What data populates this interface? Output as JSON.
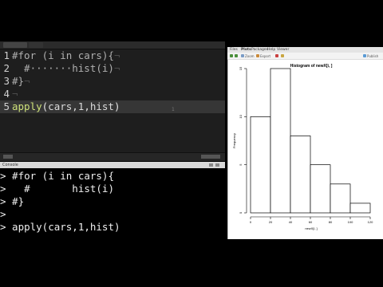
{
  "editor": {
    "lines": [
      {
        "num": "1",
        "tokens": [
          {
            "t": "#for (i in cars){",
            "c": "comment"
          },
          {
            "t": "¬",
            "c": "ws"
          }
        ]
      },
      {
        "num": "2",
        "tokens": [
          {
            "t": "  #·······hist(i)",
            "c": "comment"
          },
          {
            "t": "¬",
            "c": "ws"
          }
        ]
      },
      {
        "num": "3",
        "tokens": [
          {
            "t": "#}",
            "c": "comment"
          },
          {
            "t": "¬",
            "c": "ws"
          }
        ]
      },
      {
        "num": "4",
        "tokens": [
          {
            "t": "¬",
            "c": "ws"
          }
        ]
      },
      {
        "num": "5",
        "tokens": [
          {
            "t": "apply",
            "c": "fn"
          },
          {
            "t": "(",
            "c": "paren"
          },
          {
            "t": "cars,1,hist",
            "c": "plain"
          },
          {
            "t": ")",
            "c": "paren"
          }
        ]
      }
    ],
    "active_line": 5,
    "cursor_marker": "1"
  },
  "console": {
    "title": "Console",
    "lines": [
      "> #for (i in cars){",
      ">   #       hist(i)",
      "> #}",
      ">",
      "> apply(cars,1,hist)"
    ]
  },
  "plots_pane": {
    "tabs": [
      "Files",
      "Plots",
      "Packages",
      "Help",
      "Viewer"
    ],
    "toolbar": [
      "Zoom",
      "Export",
      "Publish"
    ]
  },
  "chart_data": {
    "type": "bar",
    "title": "Histogram of newX[i, ]",
    "xlabel": "newX[i, ]",
    "ylabel": "Frequency",
    "bins": [
      [
        0,
        20
      ],
      [
        20,
        40
      ],
      [
        40,
        60
      ],
      [
        60,
        80
      ],
      [
        80,
        100
      ],
      [
        100,
        120
      ]
    ],
    "values": [
      10,
      15,
      8,
      5,
      3,
      1
    ],
    "xticks": [
      "0",
      "20",
      "40",
      "60",
      "80",
      "100",
      "120"
    ],
    "yticks": [
      "0",
      "5",
      "10",
      "15"
    ],
    "xlim": [
      0,
      120
    ],
    "ylim": [
      0,
      15
    ],
    "colors": {
      "bar_fill": "#ffffff",
      "bar_stroke": "#000000"
    }
  }
}
